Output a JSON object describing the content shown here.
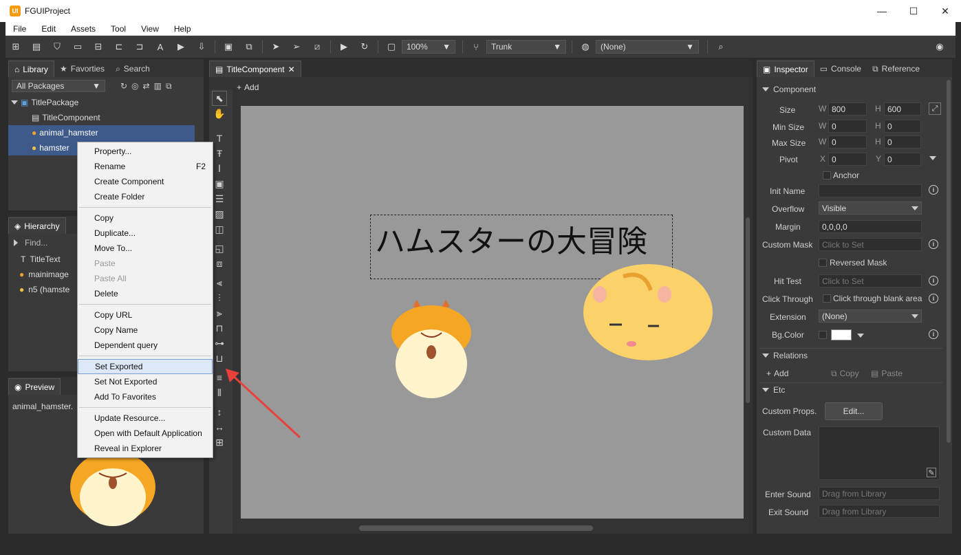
{
  "window": {
    "title": "FGUIProject",
    "logo": "UI"
  },
  "menu": [
    "File",
    "Edit",
    "Assets",
    "Tool",
    "View",
    "Help"
  ],
  "toolbar": {
    "zoom": "100%",
    "branch": "Trunk",
    "target": "(None)"
  },
  "library": {
    "tabs": [
      "Library",
      "Favorties",
      "Search"
    ],
    "package_filter": "All Packages",
    "tree": {
      "package": "TitlePackage",
      "items": [
        "TitleComponent",
        "animal_hamster",
        "hamster"
      ]
    }
  },
  "hierarchy": {
    "tab": "Hierarchy",
    "find_placeholder": "Find...",
    "items": [
      "TitleText",
      "mainimage",
      "n5 (hamste"
    ]
  },
  "preview": {
    "tab": "Preview",
    "filename": "animal_hamster."
  },
  "editor": {
    "tab": "TitleComponent",
    "add_label": "Add",
    "title_text": "ハムスターの大冒険"
  },
  "context_menu": {
    "items": [
      {
        "label": "Property...",
        "shortcut": ""
      },
      {
        "label": "Rename",
        "shortcut": "F2"
      },
      {
        "label": "Create Component",
        "shortcut": ""
      },
      {
        "label": "Create Folder",
        "shortcut": ""
      },
      {
        "label": "Copy",
        "shortcut": ""
      },
      {
        "label": "Duplicate...",
        "shortcut": ""
      },
      {
        "label": "Move To...",
        "shortcut": ""
      },
      {
        "label": "Paste",
        "shortcut": ""
      },
      {
        "label": "Paste All",
        "shortcut": ""
      },
      {
        "label": "Delete",
        "shortcut": ""
      },
      {
        "label": "Copy URL",
        "shortcut": ""
      },
      {
        "label": "Copy Name",
        "shortcut": ""
      },
      {
        "label": "Dependent query",
        "shortcut": ""
      },
      {
        "label": "Set Exported",
        "shortcut": ""
      },
      {
        "label": "Set Not Exported",
        "shortcut": ""
      },
      {
        "label": "Add To Favorites",
        "shortcut": ""
      },
      {
        "label": "Update Resource...",
        "shortcut": ""
      },
      {
        "label": "Open with Default Application",
        "shortcut": ""
      },
      {
        "label": "Reveal in Explorer",
        "shortcut": ""
      }
    ]
  },
  "inspector": {
    "tabs": [
      "Inspector",
      "Console",
      "Reference"
    ],
    "component_header": "Component",
    "size_label": "Size",
    "size_w": "800",
    "size_h": "600",
    "min_size_label": "Min Size",
    "min_w": "0",
    "min_h": "0",
    "max_size_label": "Max Size",
    "max_w": "0",
    "max_h": "0",
    "pivot_label": "Pivot",
    "pivot_x": "0",
    "pivot_y": "0",
    "w": "W",
    "h": "H",
    "x": "X",
    "y": "Y",
    "anchor_label": "Anchor",
    "init_name_label": "Init Name",
    "overflow_label": "Overflow",
    "overflow_value": "Visible",
    "margin_label": "Margin",
    "margin_value": "0,0,0,0",
    "custom_mask_label": "Custom Mask",
    "custom_mask_placeholder": "Click to Set",
    "reversed_mask_label": "Reversed Mask",
    "hit_test_label": "Hit Test",
    "hit_test_placeholder": "Click to Set",
    "click_through_label": "Click Through",
    "click_through_option": "Click through blank area",
    "extension_label": "Extension",
    "extension_value": "(None)",
    "bg_color_label": "Bg.Color",
    "relations_header": "Relations",
    "add_label": "Add",
    "copy_label": "Copy",
    "paste_label": "Paste",
    "etc_header": "Etc",
    "custom_props_label": "Custom Props.",
    "edit_button": "Edit...",
    "custom_data_label": "Custom Data",
    "enter_sound_label": "Enter Sound",
    "enter_sound_placeholder": "Drag from Library",
    "exit_sound_label": "Exit Sound",
    "exit_sound_placeholder": "Drag from Library"
  }
}
